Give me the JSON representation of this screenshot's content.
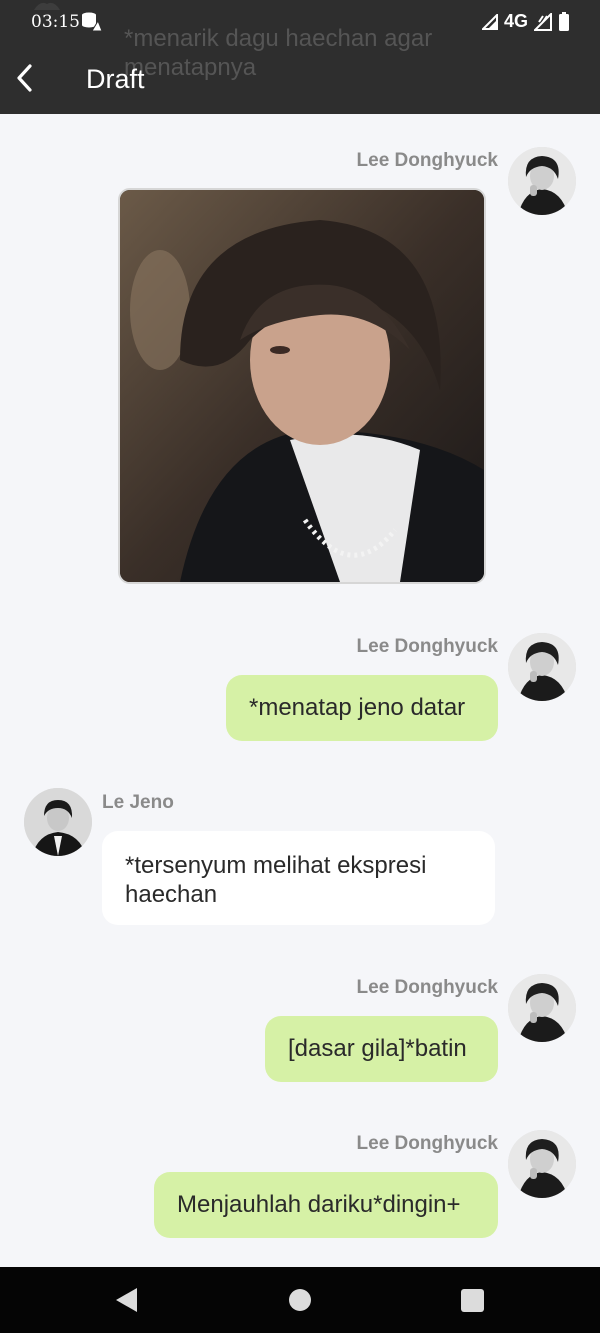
{
  "status_bar": {
    "time": "03:15",
    "network": "4G",
    "icons": [
      "data-saver-icon",
      "signal-icon",
      "mobile-data-icon",
      "battery-icon"
    ]
  },
  "header": {
    "title": "Draft",
    "back_icon": "back-arrow-icon",
    "ghost_preview": "*menarik dagu haechan agar menatapnya"
  },
  "messages": [
    {
      "sender": "Lee Donghyuck",
      "side": "right",
      "type": "image"
    },
    {
      "sender": "Lee Donghyuck",
      "side": "right",
      "type": "text",
      "text": "*menatap jeno datar"
    },
    {
      "sender": "Le Jeno",
      "side": "left",
      "type": "text",
      "text": "*tersenyum melihat ekspresi haechan"
    },
    {
      "sender": "Lee Donghyuck",
      "side": "right",
      "type": "text",
      "text": "[dasar gila]*batin"
    },
    {
      "sender": "Lee Donghyuck",
      "side": "right",
      "type": "text",
      "text": "Menjauhlah dariku*dingin+"
    }
  ],
  "colors": {
    "outgoing_bubble": "#d6f1a6",
    "incoming_bubble": "#ffffff",
    "app_bar": "#2e2e2e",
    "chat_background": "#f5f6f9"
  },
  "nav_bar": {
    "buttons": [
      "back-triangle-icon",
      "home-circle-icon",
      "recents-square-icon"
    ]
  }
}
